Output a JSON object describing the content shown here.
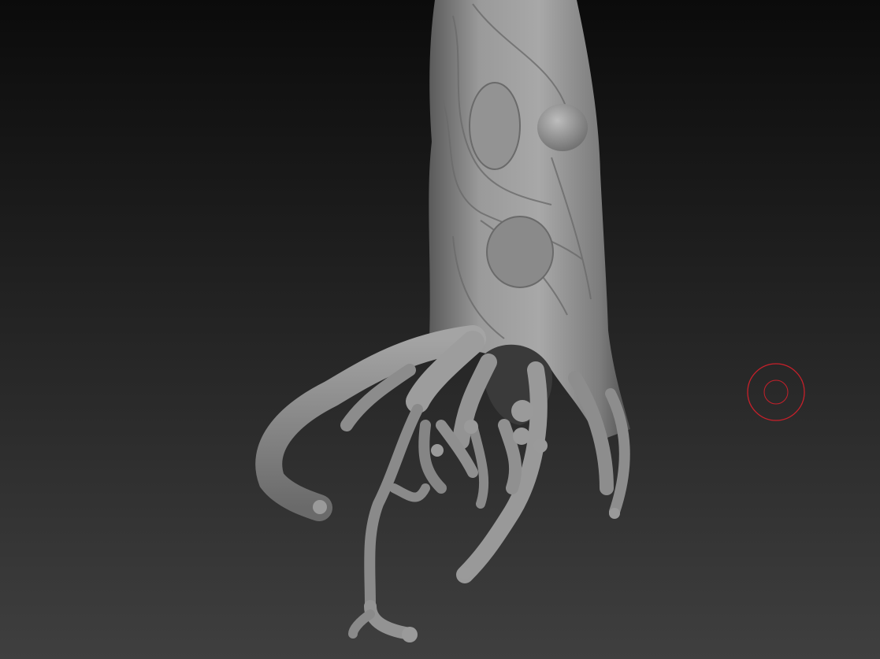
{
  "viewport": {
    "kind": "3d-sculpt-canvas",
    "background_gradient": [
      "#0b0b0b",
      "#1a1a1a",
      "#2c2c2c",
      "#3f3f3f"
    ]
  },
  "model": {
    "subject": "tree-stump-with-roots",
    "material_color": "#8e8e8e"
  },
  "brush_cursor": {
    "color": "#c8202a"
  }
}
